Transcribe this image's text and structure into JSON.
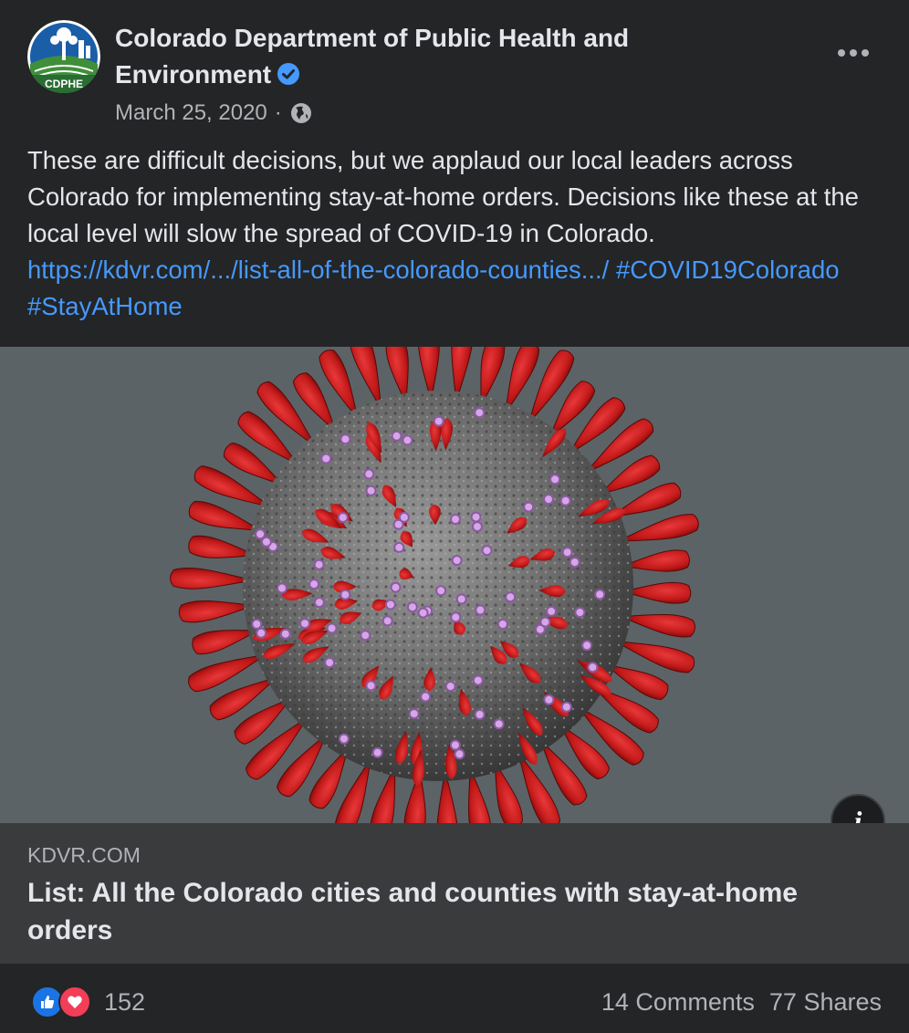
{
  "post": {
    "author": "Colorado Department of Public Health and Environment",
    "avatar_text": "CDPHE",
    "verified_icon": "verified-check-icon",
    "date": "March 25, 2020",
    "separator": "·",
    "privacy_icon": "globe-icon",
    "text": "These are difficult decisions, but we applaud our local leaders across Colorado for implementing stay-at-home orders. Decisions like these at the local level will slow the spread of COVID-19 in Colorado.",
    "link_url": "https://kdvr.com/.../list-all-of-the-colorado-counties.../",
    "hashtags": [
      "#COVID19Colorado",
      "#StayAtHome"
    ]
  },
  "link_preview": {
    "domain": "KDVR.COM",
    "title": "List: All the Colorado cities and counties with stay-at-home orders",
    "info_icon": "info-icon"
  },
  "footer": {
    "reaction_icons": [
      "like-icon",
      "love-icon"
    ],
    "reaction_count": "152",
    "comments": "14 Comments",
    "shares": "77 Shares"
  },
  "colors": {
    "background": "#242526",
    "link": "#4599ff",
    "like": "#1b74e4",
    "love": "#f33e58",
    "spike": "#c41d1d"
  }
}
